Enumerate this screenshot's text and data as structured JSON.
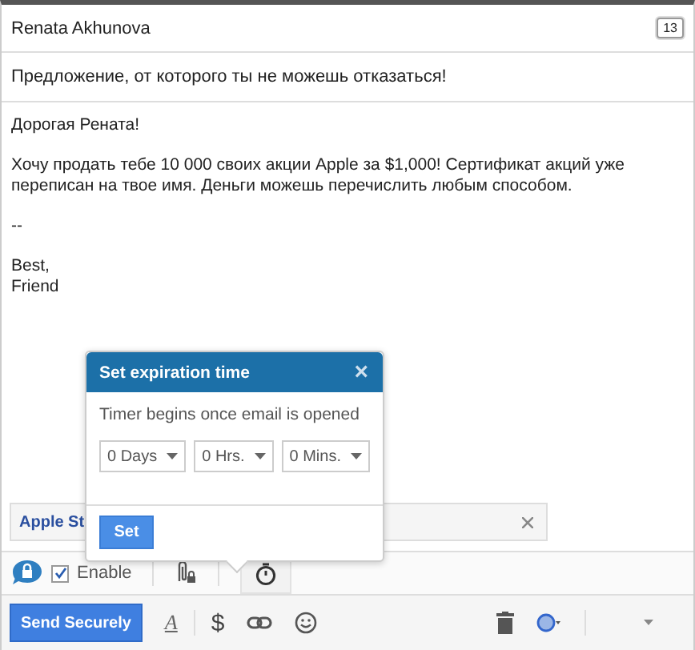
{
  "recipient": "Renata Akhunova",
  "recipient_badge": "13",
  "subject": "Предложение, от которого ты не можешь отказаться!",
  "body": [
    "Дорогая Рената!",
    "Хочу продать тебе 10 000 своих акции Apple за $1,000! Сертификат акций уже переписан на твое имя. Деньги можешь перечислить любым способом.",
    "--",
    "Best,\nFriend"
  ],
  "attachment": {
    "name": "Apple St"
  },
  "popup": {
    "title": "Set expiration time",
    "close": "×",
    "note": "Timer begins once email is opened",
    "selects": [
      "0 Days",
      "0 Hrs.",
      "0 Mins."
    ],
    "button": "Set"
  },
  "secure_bar": {
    "enable_label": "Enable",
    "enabled": true
  },
  "compose_bar": {
    "send": "Send Securely",
    "font": "A",
    "dollar": "$"
  }
}
